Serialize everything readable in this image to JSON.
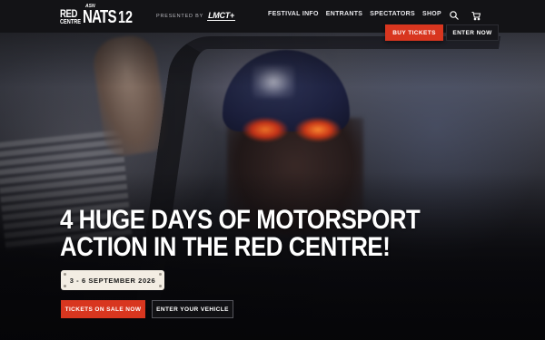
{
  "header": {
    "logo": {
      "brand": "ASN",
      "line1": "RED",
      "line2": "CENTRE",
      "main": "NATS",
      "number": "12"
    },
    "presented_by_label": "PRESENTED BY",
    "sponsor_logo": "LMCT+",
    "nav": [
      {
        "label": "FESTIVAL INFO"
      },
      {
        "label": "ENTRANTS"
      },
      {
        "label": "SPECTATORS"
      },
      {
        "label": "SHOP"
      }
    ],
    "icons": {
      "search": "search-icon",
      "cart": "cart-icon"
    }
  },
  "cta_top": {
    "buy_label": "BUY TICKETS",
    "enter_label": "ENTER NOW"
  },
  "hero": {
    "headline_line1": "4 HUGE DAYS OF MOTORSPORT",
    "headline_line2": "ACTION IN THE RED CENTRE!",
    "date": "3 - 6 SEPTEMBER 2026",
    "tickets_label": "TICKETS ON SALE NOW",
    "vehicle_label": "ENTER YOUR VEHICLE"
  },
  "colors": {
    "accent": "#d8361f",
    "header_bg": "#131316",
    "badge_bg": "#f3ede3"
  }
}
